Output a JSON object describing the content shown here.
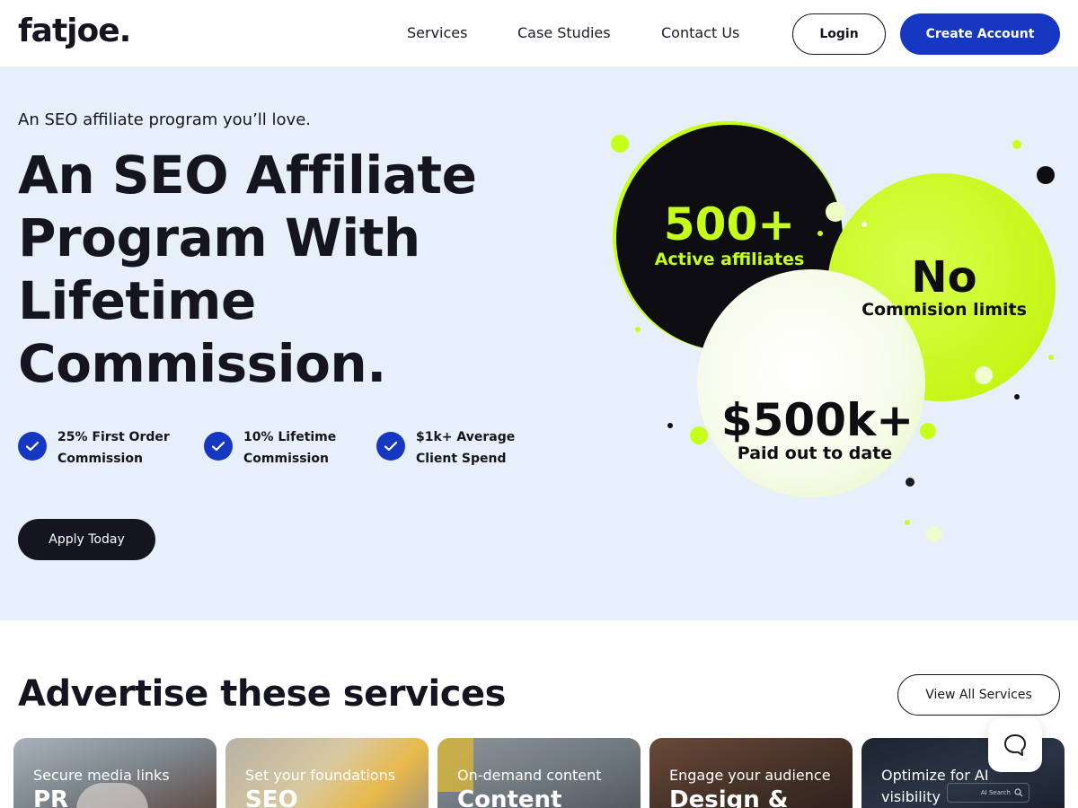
{
  "header": {
    "logo": "fatjoe.",
    "nav": [
      "Services",
      "Case Studies",
      "Contact Us"
    ],
    "login_label": "Login",
    "create_label": "Create Account"
  },
  "hero": {
    "eyebrow": "An SEO affiliate program you’ll love.",
    "title_lines": [
      "An SEO Affiliate",
      "Program With",
      "Lifetime",
      "Commission."
    ],
    "features": [
      {
        "line1": "25% First Order",
        "line2": "Commission"
      },
      {
        "line1": "10% Lifetime",
        "line2": "Commission"
      },
      {
        "line1": "$1k+ Average",
        "line2": "Client Spend"
      }
    ],
    "apply_label": "Apply Today",
    "stats": {
      "affiliates_value": "500+",
      "affiliates_label": "Active affiliates",
      "limits_value": "No",
      "limits_label": "Commision limits",
      "paid_value": "$500k+",
      "paid_label": "Paid out to date"
    }
  },
  "services": {
    "title": "Advertise these services",
    "view_all_label": "View All Services",
    "cards": [
      {
        "sub": "Secure media links",
        "title": "PR"
      },
      {
        "sub": "Set your foundations",
        "title": "SEO"
      },
      {
        "sub": "On-demand content",
        "title": "Content"
      },
      {
        "sub": "Engage your audience",
        "title": "Design &"
      },
      {
        "sub": "Optimize for AI visibility",
        "title": ""
      }
    ],
    "ai_search_label": "AI Search"
  },
  "colors": {
    "brand_blue": "#1637c2",
    "lime": "#c5ff1a",
    "dark": "#151521",
    "hero_bg": "#e7effb"
  },
  "icons": [
    "check-icon",
    "chat-icon",
    "search-icon"
  ]
}
